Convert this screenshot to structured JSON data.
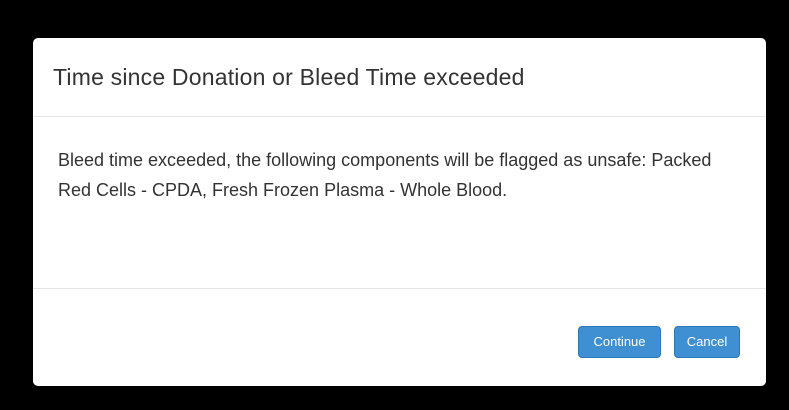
{
  "dialog": {
    "title": "Time since Donation or Bleed Time exceeded",
    "message": "Bleed time exceeded, the following components will be flagged as unsafe: Packed Red Cells - CPDA, Fresh Frozen Plasma - Whole Blood.",
    "buttons": {
      "continue_label": "Continue",
      "cancel_label": "Cancel"
    }
  },
  "colors": {
    "backdrop": "#000000",
    "modal_background": "#ffffff",
    "button_primary": "#3f8fd3",
    "text": "#333333",
    "divider": "#e5e5e5"
  }
}
